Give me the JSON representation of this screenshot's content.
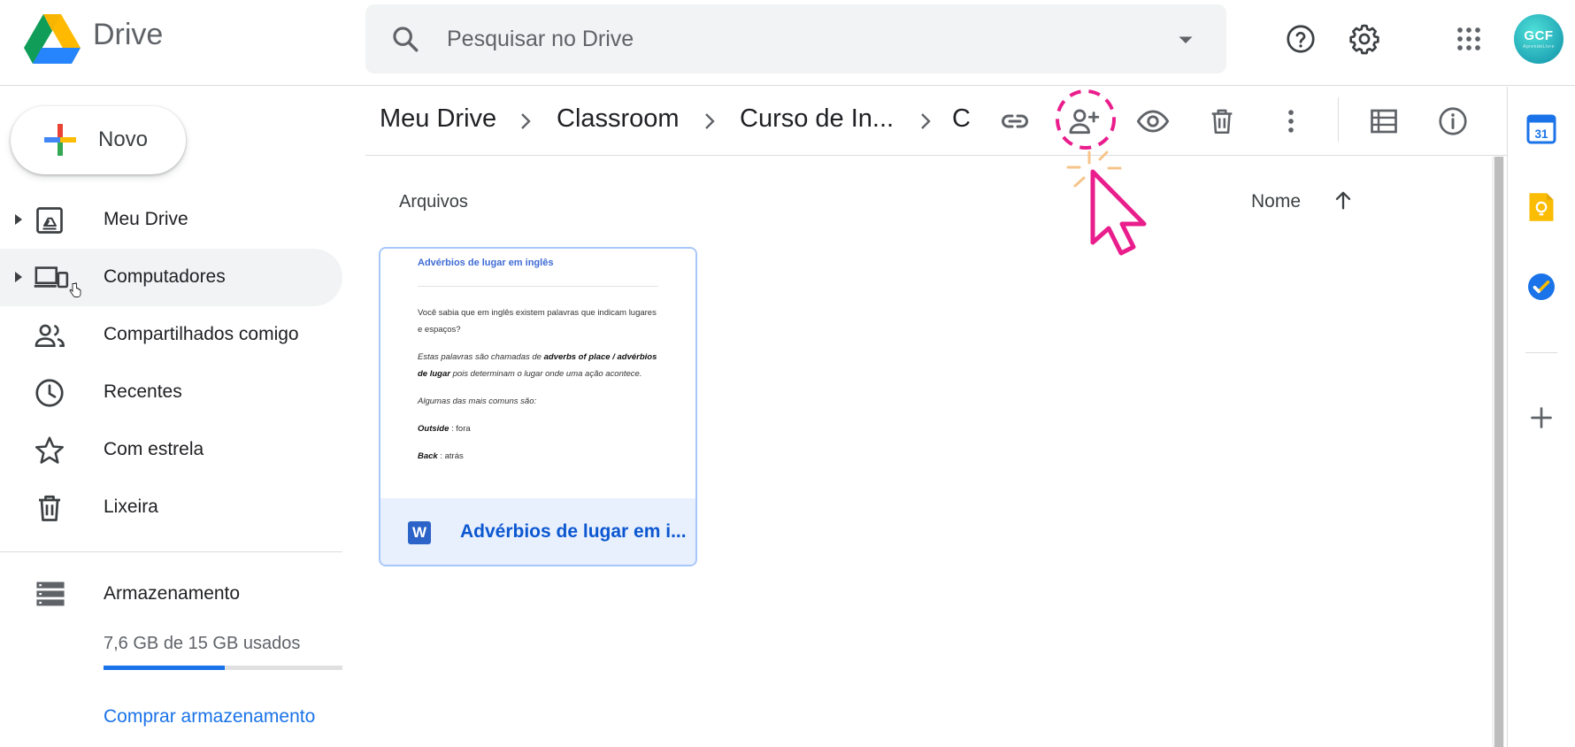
{
  "header": {
    "product_name": "Drive",
    "search_placeholder": "Pesquisar no Drive",
    "avatar_text": "GCF",
    "avatar_subtext": "AprendeLivre"
  },
  "sidebar": {
    "new_button_label": "Novo",
    "items": [
      {
        "label": "Meu Drive",
        "icon": "my-drive-icon",
        "expandable": true
      },
      {
        "label": "Computadores",
        "icon": "computers-icon",
        "expandable": true,
        "hovered": true
      },
      {
        "label": "Compartilhados comigo",
        "icon": "shared-icon",
        "expandable": false
      },
      {
        "label": "Recentes",
        "icon": "clock-icon",
        "expandable": false
      },
      {
        "label": "Com estrela",
        "icon": "star-icon",
        "expandable": false
      },
      {
        "label": "Lixeira",
        "icon": "trash-icon",
        "expandable": false
      }
    ],
    "storage": {
      "label": "Armazenamento",
      "usage_text": "7,6 GB de 15 GB usados",
      "used_fraction": 0.507,
      "buy_label": "Comprar armazenamento"
    }
  },
  "breadcrumb": [
    "Meu Drive",
    "Classroom",
    "Curso de In...",
    "C"
  ],
  "toolbar": {
    "actions": [
      "link-icon",
      "add-person-icon",
      "eye-icon",
      "trash-icon",
      "more-vert-icon"
    ],
    "view_actions": [
      "list-view-icon",
      "info-icon"
    ]
  },
  "content": {
    "section_title": "Arquivos",
    "sort_label": "Nome",
    "files": [
      {
        "name": "Advérbios de lugar em i...",
        "type": "word",
        "type_letter": "W",
        "preview": {
          "title": "Advérbios de lugar em inglês",
          "p1": "Você sabia que em inglês existem palavras que indicam lugares e espaços?",
          "p2_a": "Estas palavras são chamadas de ",
          "p2_b": "adverbs of place / advérbios de lugar",
          "p2_c": " pois determinam o lugar onde uma ação acontece.",
          "p3": "Algumas das mais comuns são:",
          "p4_term": "Outside",
          "p4_def": " : fora",
          "p5_term": "Back",
          "p5_def": " : atrás"
        }
      }
    ]
  },
  "side_panel": [
    "calendar-icon",
    "keep-icon",
    "tasks-icon",
    "add-icon"
  ],
  "side_panel_calendar_day": "31",
  "colors": {
    "accent": "#1a73e8",
    "highlight_pink": "#e91e8c",
    "selected_card": "#e8f0fe"
  }
}
